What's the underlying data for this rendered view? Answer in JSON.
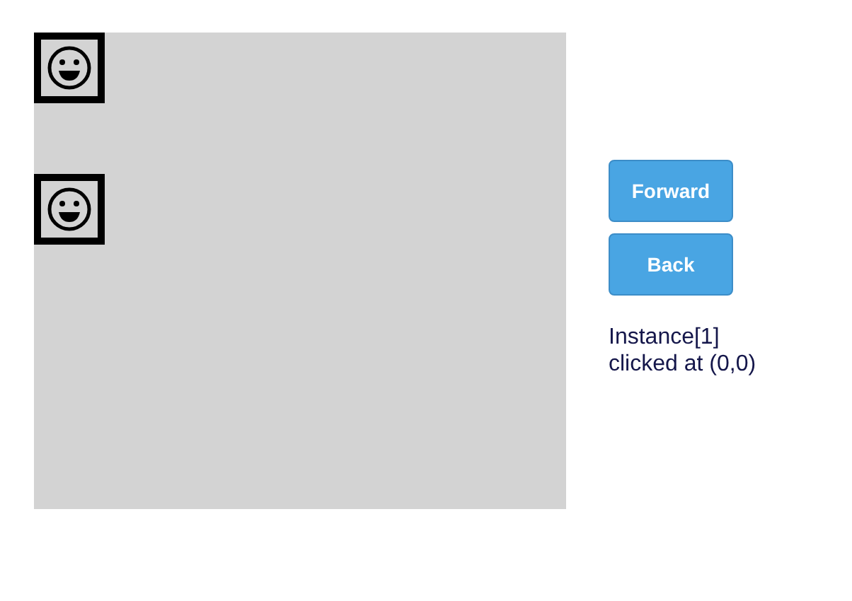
{
  "canvas": {
    "tiles": [
      {
        "kind": "smiley"
      },
      {
        "kind": "smiley"
      }
    ]
  },
  "buttons": [
    "Forward",
    "Back"
  ],
  "status": "Instance[1] clicked at (0,0)"
}
